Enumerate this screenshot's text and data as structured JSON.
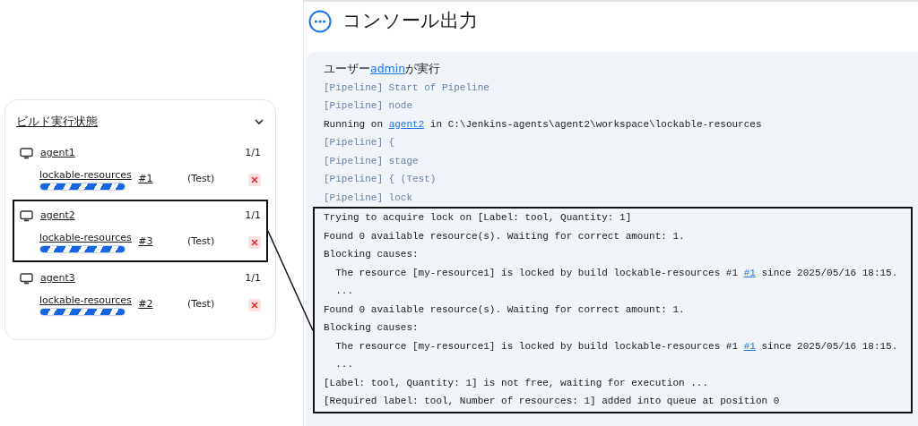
{
  "executors_panel": {
    "title": "ビルド実行状態",
    "expanded": true,
    "executors": [
      {
        "name": "agent1",
        "usage": "1/1",
        "highlighted": false,
        "build": {
          "job": "lockable-resources",
          "number": "#1",
          "stage": "(Test)"
        }
      },
      {
        "name": "agent2",
        "usage": "1/1",
        "highlighted": true,
        "build": {
          "job": "lockable-resources",
          "number": "#3",
          "stage": "(Test)"
        }
      },
      {
        "name": "agent3",
        "usage": "1/1",
        "highlighted": false,
        "build": {
          "job": "lockable-resources",
          "number": "#2",
          "stage": "(Test)"
        }
      }
    ]
  },
  "console": {
    "title": "コンソール出力",
    "lines": [
      {
        "parts": [
          {
            "text": "ユーザー",
            "kind": "plain"
          },
          {
            "text": "admin",
            "kind": "link"
          },
          {
            "text": "が実行",
            "kind": "plain"
          }
        ]
      },
      {
        "parts": [
          {
            "text": "[Pipeline] Start of Pipeline",
            "kind": "pipeline"
          }
        ]
      },
      {
        "parts": [
          {
            "text": "[Pipeline] node",
            "kind": "pipeline"
          }
        ]
      },
      {
        "parts": [
          {
            "text": "Running on ",
            "kind": "plain"
          },
          {
            "text": "agent2",
            "kind": "link"
          },
          {
            "text": " in C:\\Jenkins-agents\\agent2\\workspace\\lockable-resources",
            "kind": "plain"
          }
        ]
      },
      {
        "parts": [
          {
            "text": "[Pipeline] {",
            "kind": "pipeline"
          }
        ]
      },
      {
        "parts": [
          {
            "text": "[Pipeline] stage",
            "kind": "pipeline"
          }
        ]
      },
      {
        "parts": [
          {
            "text": "[Pipeline] { (Test)",
            "kind": "pipeline"
          }
        ]
      },
      {
        "parts": [
          {
            "text": "[Pipeline] lock",
            "kind": "pipeline"
          }
        ]
      }
    ],
    "callout_lines": [
      {
        "parts": [
          {
            "text": "Trying to acquire lock on [Label: tool, Quantity: 1]",
            "kind": "plain"
          }
        ]
      },
      {
        "parts": [
          {
            "text": "Found 0 available resource(s). Waiting for correct amount: 1.",
            "kind": "plain"
          }
        ]
      },
      {
        "parts": [
          {
            "text": "Blocking causes:",
            "kind": "plain"
          }
        ]
      },
      {
        "parts": [
          {
            "text": "  The resource [my-resource1] is locked by build lockable-resources #1 ",
            "kind": "plain"
          },
          {
            "text": "#1",
            "kind": "link"
          },
          {
            "text": " since 2025/05/16 18:15.",
            "kind": "plain"
          }
        ]
      },
      {
        "parts": [
          {
            "text": "  ...",
            "kind": "plain"
          }
        ]
      },
      {
        "parts": [
          {
            "text": "Found 0 available resource(s). Waiting for correct amount: 1.",
            "kind": "plain"
          }
        ]
      },
      {
        "parts": [
          {
            "text": "Blocking causes:",
            "kind": "plain"
          }
        ]
      },
      {
        "parts": [
          {
            "text": "  The resource [my-resource1] is locked by build lockable-resources #1 ",
            "kind": "plain"
          },
          {
            "text": "#1",
            "kind": "link"
          },
          {
            "text": " since 2025/05/16 18:15.",
            "kind": "plain"
          }
        ]
      },
      {
        "parts": [
          {
            "text": "  ...",
            "kind": "plain"
          }
        ]
      },
      {
        "parts": [
          {
            "text": "[Label: tool, Quantity: 1] is not free, waiting for execution ...",
            "kind": "plain"
          }
        ]
      },
      {
        "parts": [
          {
            "text": "[Required label: tool, Number of resources: 1] added into queue at position 0",
            "kind": "plain"
          }
        ]
      }
    ]
  }
}
